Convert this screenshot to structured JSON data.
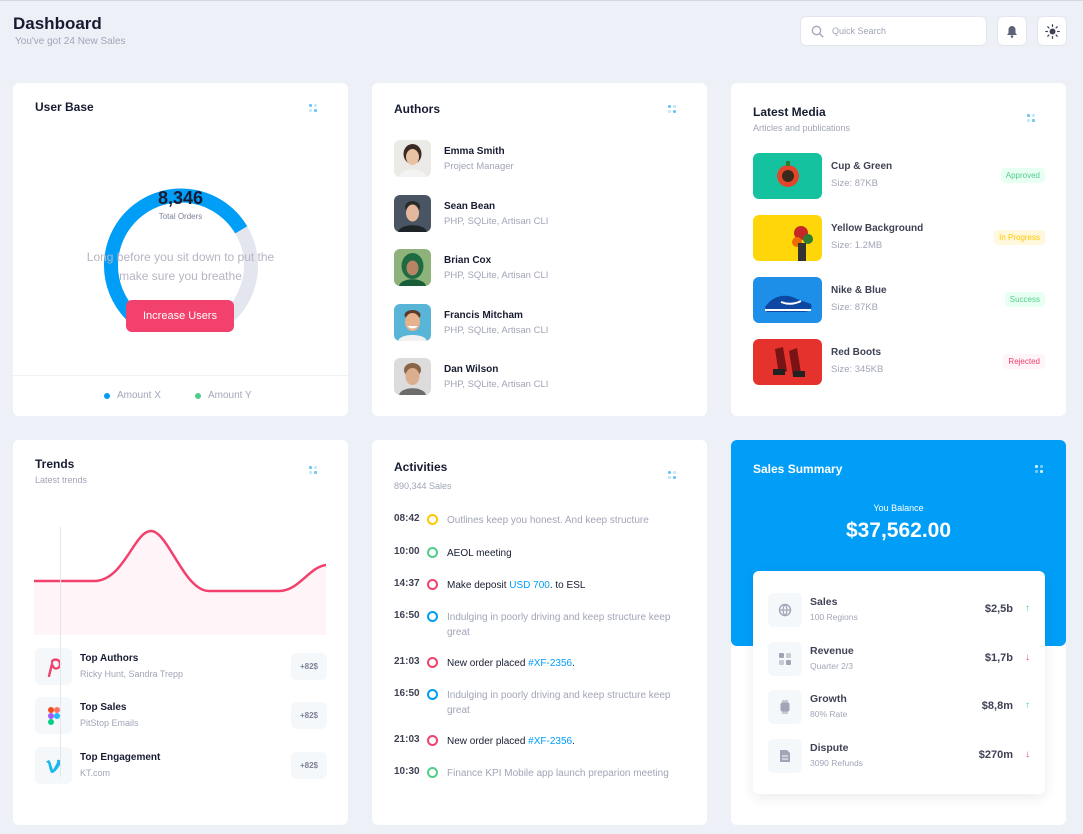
{
  "header": {
    "title": "Dashboard",
    "subtitle": "You've got 24 New Sales",
    "search_placeholder": "Quick Search"
  },
  "user_base": {
    "title": "User Base",
    "gauge_value": "8,346",
    "gauge_label": "Total Orders",
    "gauge_fill_fraction": 0.72,
    "text_line1": "Long before you sit down to put the",
    "text_line2": "make sure you breathe",
    "button": "Increase Users",
    "legend": [
      {
        "label": "Amount X",
        "color": "#009ef7"
      },
      {
        "label": "Amount Y",
        "color": "#50cd89"
      }
    ]
  },
  "authors": {
    "title": "Authors",
    "items": [
      {
        "name": "Emma Smith",
        "role": "Project Manager"
      },
      {
        "name": "Sean Bean",
        "role": "PHP, SQLite, Artisan CLI"
      },
      {
        "name": "Brian Cox",
        "role": "PHP, SQLite, Artisan CLI"
      },
      {
        "name": "Francis Mitcham",
        "role": "PHP, SQLite, Artisan CLI"
      },
      {
        "name": "Dan Wilson",
        "role": "PHP, SQLite, Artisan CLI"
      }
    ]
  },
  "media": {
    "title": "Latest Media",
    "subtitle": "Articles and publications",
    "items": [
      {
        "name": "Cup & Green",
        "size": "Size: 87KB",
        "badge": "Approved",
        "badge_color": "#50cd89",
        "badge_bg": "#e8fff3",
        "thumb_color": "#14c2a0"
      },
      {
        "name": "Yellow Background",
        "size": "Size: 1.2MB",
        "badge": "In Progress",
        "badge_color": "#ffc700",
        "badge_bg": "#fff8dd",
        "thumb_color": "#ffd60a"
      },
      {
        "name": "Nike & Blue",
        "size": "Size: 87KB",
        "badge": "Success",
        "badge_color": "#50cd89",
        "badge_bg": "#e8fff3",
        "thumb_color": "#1e8fe8"
      },
      {
        "name": "Red Boots",
        "size": "Size: 345KB",
        "badge": "Rejected",
        "badge_color": "#f1416c",
        "badge_bg": "#fff5f8",
        "thumb_color": "#e5322d"
      }
    ]
  },
  "trends": {
    "title": "Trends",
    "subtitle": "Latest trends",
    "items": [
      {
        "name": "Top Authors",
        "sub": "Ricky Hunt, Sandra Trepp",
        "value": "+82$"
      },
      {
        "name": "Top Sales",
        "sub": "PitStop Emails",
        "value": "+82$"
      },
      {
        "name": "Top Engagement",
        "sub": "KT.com",
        "value": "+82$"
      }
    ]
  },
  "activities": {
    "title": "Activities",
    "subtitle": "890,344 Sales",
    "items": [
      {
        "time": "08:42",
        "color": "#ffc700",
        "pre": "Outlines keep you honest. And keep structure",
        "link": "",
        "post": "",
        "dark": false
      },
      {
        "time": "10:00",
        "color": "#50cd89",
        "pre": "AEOL meeting",
        "link": "",
        "post": "",
        "dark": true
      },
      {
        "time": "14:37",
        "color": "#f1416c",
        "pre": "Make deposit ",
        "link": "USD 700",
        "post": ". to ESL",
        "dark": true
      },
      {
        "time": "16:50",
        "color": "#009ef7",
        "pre": "Indulging in poorly driving and keep structure keep great",
        "link": "",
        "post": "",
        "dark": false
      },
      {
        "time": "21:03",
        "color": "#f1416c",
        "pre": "New order placed ",
        "link": "#XF-2356",
        "post": ".",
        "dark": true
      },
      {
        "time": "16:50",
        "color": "#009ef7",
        "pre": "Indulging in poorly driving and keep structure keep great",
        "link": "",
        "post": "",
        "dark": false
      },
      {
        "time": "21:03",
        "color": "#f1416c",
        "pre": "New order placed ",
        "link": "#XF-2356",
        "post": ".",
        "dark": true
      },
      {
        "time": "10:30",
        "color": "#50cd89",
        "pre": "Finance KPI Mobile app launch preparion meeting",
        "link": "",
        "post": "",
        "dark": false
      }
    ]
  },
  "sales_summary": {
    "title": "Sales Summary",
    "balance_label": "You Balance",
    "balance": "$37,562.00",
    "items": [
      {
        "name": "Sales",
        "sub": "100 Regions",
        "value": "$2,5b",
        "arrow": "↑",
        "arrow_color": "#50cd89"
      },
      {
        "name": "Revenue",
        "sub": "Quarter 2/3",
        "value": "$1,7b",
        "arrow": "↓",
        "arrow_color": "#f1416c"
      },
      {
        "name": "Growth",
        "sub": "80% Rate",
        "value": "$8,8m",
        "arrow": "↑",
        "arrow_color": "#50cd89"
      },
      {
        "name": "Dispute",
        "sub": "3090 Refunds",
        "value": "$270m",
        "arrow": "↓",
        "arrow_color": "#f1416c"
      }
    ]
  }
}
